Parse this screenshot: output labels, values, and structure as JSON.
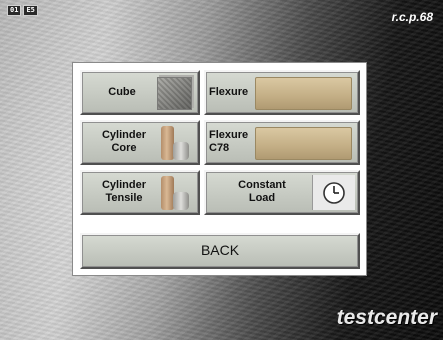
{
  "header": {
    "indicator_left": "01",
    "indicator_right": "E5",
    "version": "r.c.p.68"
  },
  "brand": "testcenter",
  "menu": {
    "cube": "Cube",
    "flexure": "Flexure",
    "cylinder_core": [
      "Cylinder",
      "Core"
    ],
    "flexure_c78": [
      "Flexure",
      "C78"
    ],
    "cylinder_tensile": [
      "Cylinder",
      "Tensile"
    ],
    "constant_load": [
      "Constant",
      "Load"
    ],
    "back": "BACK"
  },
  "icons": {
    "cube": "cube-specimen-icon",
    "flexure": "beam-specimen-icon",
    "cylinder": "cylinder-specimen-icon",
    "clock": "clock-icon"
  },
  "colors": {
    "tile": "#c8ccc4",
    "panel": "#ffffff",
    "text": "#111111"
  }
}
